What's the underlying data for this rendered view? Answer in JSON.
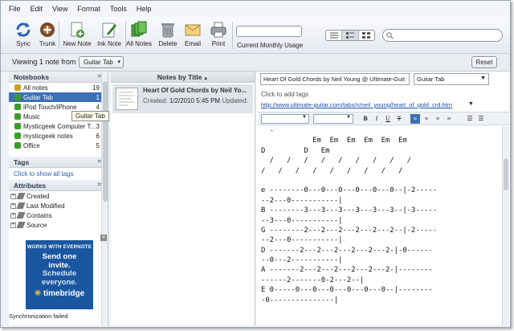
{
  "menu": [
    "File",
    "Edit",
    "View",
    "Format",
    "Tools",
    "Help"
  ],
  "toolbar": {
    "buttons": [
      "Sync",
      "Trunk",
      "New Note",
      "Ink Note",
      "All Notes",
      "Delete",
      "Email",
      "Print"
    ],
    "usage_label": "Current Monthly Usage",
    "search_placeholder": ""
  },
  "subbar": {
    "viewing": "Viewing 1 note from",
    "notebook": "Guitar Tab",
    "reset": "Reset"
  },
  "sidebar": {
    "notebooks_header": "Notebooks",
    "notebooks": [
      {
        "name": "All notes",
        "count": "19"
      },
      {
        "name": "Guitar Tab",
        "count": "1"
      },
      {
        "name": "iPod Touch/iPhone",
        "count": "4"
      },
      {
        "name": "Music",
        "count": ""
      },
      {
        "name": "Mysticgeek Computer T...",
        "count": "3"
      },
      {
        "name": "mysticgeek notes",
        "count": "6"
      },
      {
        "name": "Office",
        "count": "5"
      }
    ],
    "tags_header": "Tags",
    "tags_hint": "Click to show all tags",
    "attributes_header": "Attributes",
    "attributes": [
      "Created",
      "Last Modified",
      "Contains",
      "Source"
    ],
    "tooltip": "Guitar Tab",
    "sync_status": "Synchronization failed"
  },
  "ad": {
    "top": "WORKS WITH EVERNOTE",
    "line1": "Send one",
    "line2": "invite.",
    "line3": "Schedule",
    "line4": "everyone.",
    "brand": "timebridge"
  },
  "notelist": {
    "header": "Notes by Title",
    "note_title": "Heart Of Gold Chords by Neil Yo...",
    "created_label": "Created:",
    "created_value": "1/2/2010 5:45 PM",
    "updated_label": "Updated:"
  },
  "editor": {
    "title": "Heart Of Gold Chords by Neil Young @ Ultimate-Guit",
    "notebook": "Guitar Tab",
    "add_tags": "Click to add tags",
    "url": "http://www.ultimate-guitar.com/tabs/n/neil_young/heart_of_gold_crd.htm",
    "body_lines": [
      "  -",
      "            Em  Em  Em  Em  Em  Em",
      "D         D   Em",
      "  /   /   /   /   /   /   /   /   /",
      "/   /   /   /   /   /   /   /   /",
      "",
      "e --------0---0---0---0---0---0--|-2-----",
      "--2---0-----------|",
      "B --------3---3---3---3---3---3--|-3-----",
      "--3---0-----------|",
      "G --------2---2---2---2---2---2--|-2-----",
      "--2---0-----------|",
      "D -------2---2---2---2---2---2-|-0------",
      "--0---2-----------|",
      "A -------2---2---2---2---2---2-|--------",
      "------2-------0-2---2--|",
      "E 0-----0---0---0---0---0---0--|--------",
      "-0---------------|"
    ]
  },
  "colors": {
    "selection": "#3d6fb5",
    "link": "#1a4fb0",
    "ad_bg": "#1b57a0"
  }
}
